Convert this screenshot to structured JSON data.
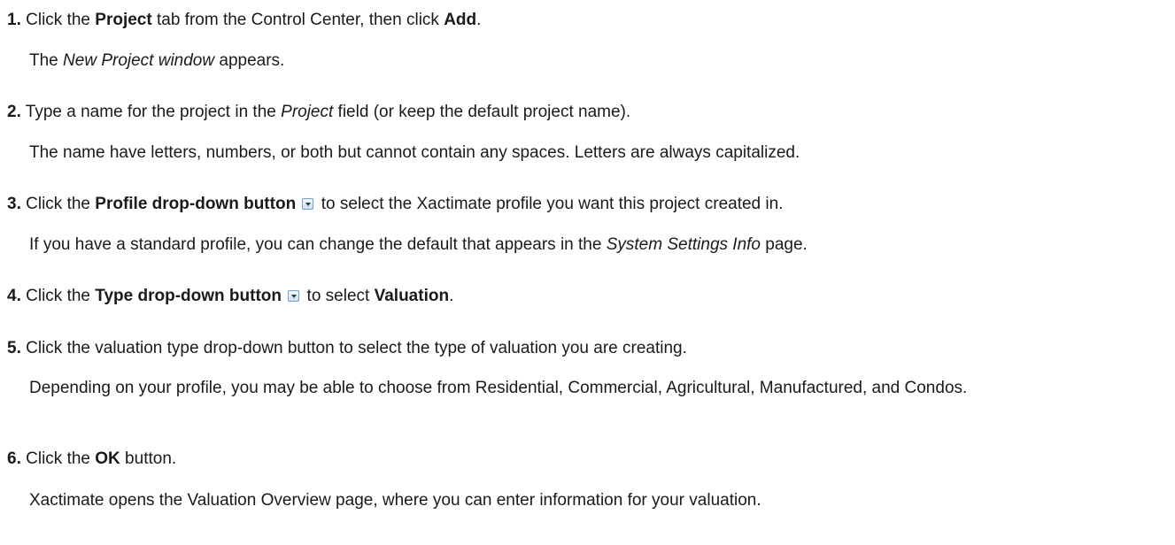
{
  "steps": [
    {
      "num": "1.",
      "t1": " Click the ",
      "b1": "Project",
      "t2": " tab from the Control Center, then click ",
      "b2": "Add",
      "t3": ".",
      "note_i": "New Project window",
      "note_pre": "The ",
      "note_post": " appears."
    },
    {
      "num": "2.",
      "t1": " Type a name for the project in the ",
      "i1": "Project",
      "t2": " field (or keep the default project name).",
      "note": "The name have letters, numbers, or both but cannot contain any spaces. Letters are always capitalized."
    },
    {
      "num": "3.",
      "t1": " Click the ",
      "b1": "Profile drop-down button",
      "t2": " to select the Xactimate profile you want this project created in.",
      "note_pre": "If you have a standard profile, you can change the default that appears in the ",
      "note_i": "System Settings Info",
      "note_post": " page."
    },
    {
      "num": "4.",
      "t1": " Click the ",
      "b1": "Type drop-down button",
      "t2": " to select ",
      "b2": "Valuation",
      "t3": "."
    },
    {
      "num": "5.",
      "t1": " Click the valuation type drop-down button to select the type of valuation you are creating.",
      "note": "Depending on your profile, you may be able to choose from Residential, Commercial, Agricultural, Manufactured, and Condos."
    },
    {
      "num": "6.",
      "t1": " Click the ",
      "b1": "OK",
      "t2": " button.",
      "note": "Xactimate opens the Valuation Overview page, where you can enter information for your valuation."
    }
  ],
  "icons": {
    "dropdown": "chevron-down-icon"
  }
}
